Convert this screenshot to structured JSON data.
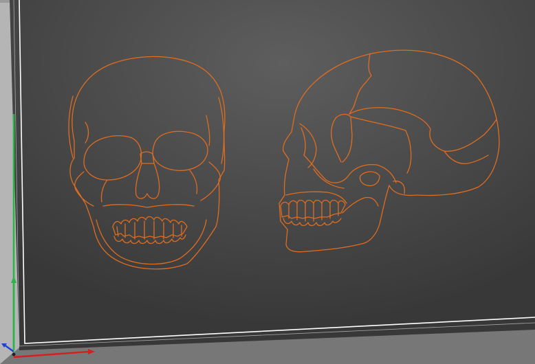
{
  "app": {
    "view": "3d-viewport",
    "content": "vector-toolpath-preview"
  },
  "colors": {
    "background_light": "#5c5c5c",
    "background_dark": "#3a3a3a",
    "bed_border": "#ffffff",
    "toolpath": "#e06d1f",
    "axis_x": "#d42020",
    "axis_y": "#2bb34a",
    "axis_z": "#2040d8",
    "frame_side": "#b9b9b9"
  },
  "objects": [
    {
      "name": "skull-front-view"
    },
    {
      "name": "skull-side-view"
    }
  ],
  "axes": [
    "x",
    "y",
    "z"
  ]
}
